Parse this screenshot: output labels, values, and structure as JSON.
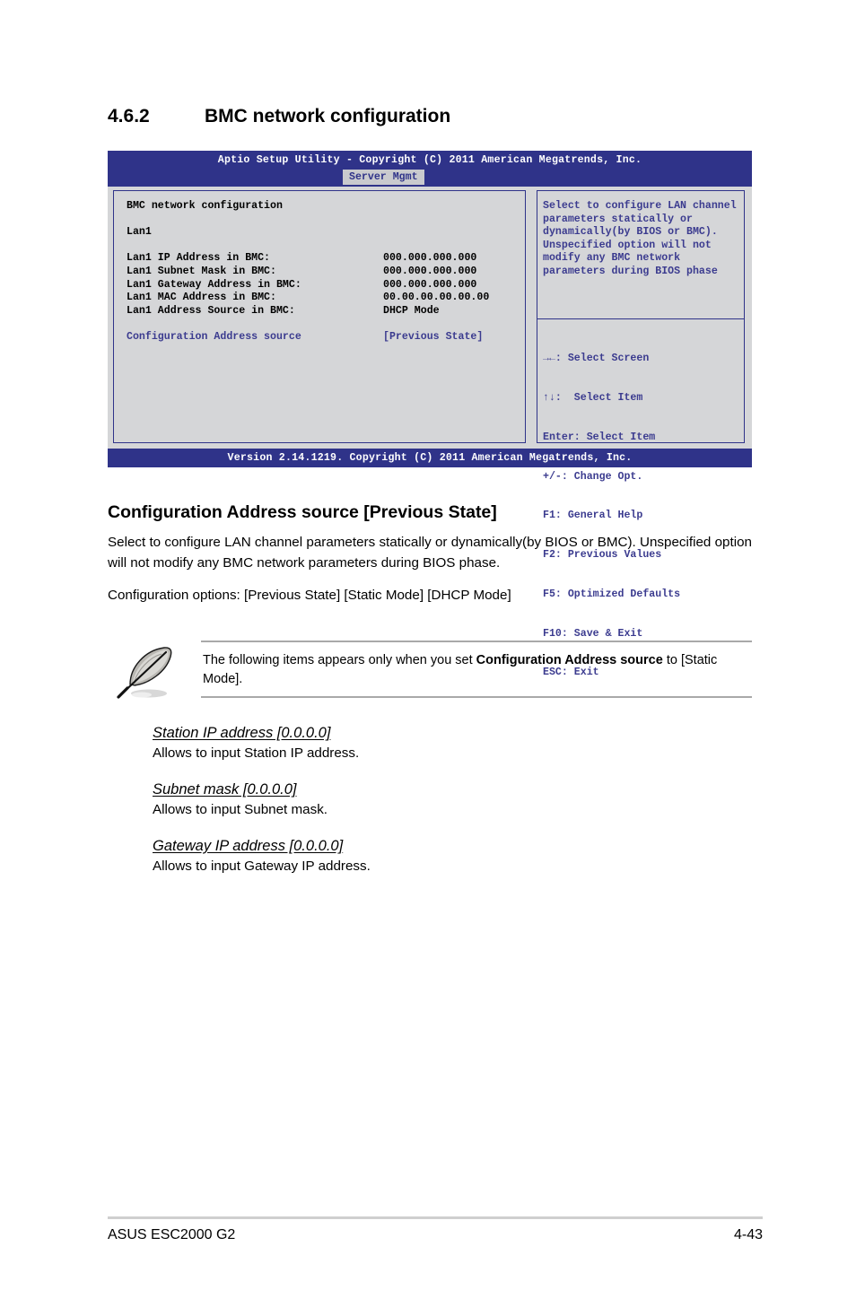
{
  "section": {
    "number": "4.6.2",
    "title": "BMC network configuration"
  },
  "bios": {
    "titlebar": "Aptio Setup Utility - Copyright (C) 2011 American Megatrends, Inc.",
    "tab": "Server Mgmt",
    "screen_title": "BMC network configuration",
    "group_label": "Lan1",
    "rows": [
      {
        "label": "Lan1 IP Address in BMC:",
        "value": "000.000.000.000"
      },
      {
        "label": "Lan1 Subnet Mask in BMC:",
        "value": "000.000.000.000"
      },
      {
        "label": "Lan1 Gateway Address in BMC:",
        "value": "000.000.000.000"
      },
      {
        "label": "Lan1 MAC Address in BMC:",
        "value": "00.00.00.00.00.00"
      },
      {
        "label": "Lan1 Address Source in BMC:",
        "value": "DHCP Mode"
      }
    ],
    "selected_row": {
      "label": "Configuration Address source",
      "value": "[Previous State]"
    },
    "help_text": "Select to configure LAN channel parameters statically or dynamically(by BIOS or BMC). Unspecified option will not modify any BMC network parameters during BIOS phase",
    "keys": [
      "→←: Select Screen",
      "↑↓:  Select Item",
      "Enter: Select Item",
      "+/-: Change Opt.",
      "F1: General Help",
      "F2: Previous Values",
      "F5: Optimized Defaults",
      "F10: Save & Exit",
      "ESC: Exit"
    ],
    "footer": "Version 2.14.1219. Copyright (C) 2011 American Megatrends, Inc.",
    "colors": {
      "chrome_blue": "#2f3389",
      "panel_gray": "#d5d6d8",
      "highlight_blue": "#3b3b8f",
      "tab_gray": "#c9cace"
    }
  },
  "item": {
    "heading": "Configuration Address source [Previous State]",
    "description": "Select to configure LAN channel parameters statically or dynamically(by BIOS or BMC). Unspecified option will not modify any BMC network parameters during BIOS phase.",
    "options_line": "Configuration options: [Previous State] [Static Mode] [DHCP Mode]"
  },
  "note": {
    "icon": "quill-pen-icon",
    "text_before": "The following items appears only when you set ",
    "text_bold": "Configuration Address source",
    "text_after": " to [Static Mode]."
  },
  "sub_items": [
    {
      "title": "Station IP address [0.0.0.0]",
      "desc": "Allows to input Station IP address."
    },
    {
      "title": "Subnet mask [0.0.0.0]",
      "desc": "Allows to input Subnet mask."
    },
    {
      "title": "Gateway IP address [0.0.0.0]",
      "desc": "Allows to input Gateway IP address."
    }
  ],
  "footer": {
    "product": "ASUS ESC2000 G2",
    "page": "4-43"
  }
}
